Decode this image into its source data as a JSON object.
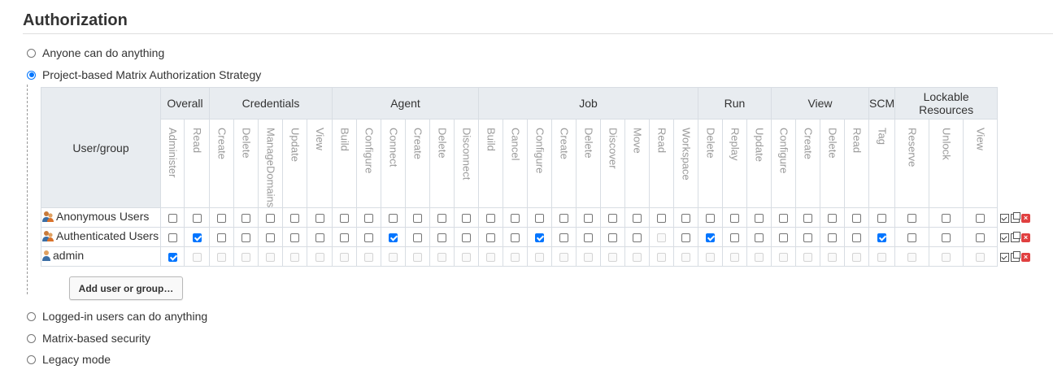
{
  "section": {
    "title": "Authorization"
  },
  "strategies": [
    {
      "label": "Anyone can do anything",
      "selected": false
    },
    {
      "label": "Project-based Matrix Authorization Strategy",
      "selected": true
    },
    {
      "label": "Logged-in users can do anything",
      "selected": false
    },
    {
      "label": "Matrix-based security",
      "selected": false
    },
    {
      "label": "Legacy mode",
      "selected": false
    }
  ],
  "matrix": {
    "user_group_header": "User/group",
    "groups": [
      {
        "label": "Overall",
        "permissions": [
          "Administer",
          "Read"
        ]
      },
      {
        "label": "Credentials",
        "permissions": [
          "Create",
          "Delete",
          "ManageDomains",
          "Update",
          "View"
        ]
      },
      {
        "label": "Agent",
        "permissions": [
          "Build",
          "Configure",
          "Connect",
          "Create",
          "Delete",
          "Disconnect"
        ]
      },
      {
        "label": "Job",
        "permissions": [
          "Build",
          "Cancel",
          "Configure",
          "Create",
          "Delete",
          "Discover",
          "Move",
          "Read",
          "Workspace"
        ]
      },
      {
        "label": "Run",
        "permissions": [
          "Delete",
          "Replay",
          "Update"
        ]
      },
      {
        "label": "View",
        "permissions": [
          "Configure",
          "Create",
          "Delete",
          "Read"
        ]
      },
      {
        "label": "SCM",
        "permissions": [
          "Tag"
        ]
      },
      {
        "label": "Lockable Resources",
        "permissions": [
          "Reserve",
          "Unlock",
          "View"
        ]
      }
    ],
    "rows": [
      {
        "name": "Anonymous Users",
        "icon": "group-icon",
        "disabled_all": false,
        "checked": [],
        "disabled": []
      },
      {
        "name": "Authenticated Users",
        "icon": "group-icon",
        "disabled_all": false,
        "checked": [
          1,
          9,
          15,
          22,
          29
        ],
        "disabled": [
          20
        ]
      },
      {
        "name": "admin",
        "icon": "user-icon",
        "disabled_all": true,
        "checked": [
          0
        ],
        "disabled": []
      }
    ],
    "row_action_icons": [
      "select-all-icon",
      "copy-icon",
      "delete-icon"
    ]
  },
  "add_button": {
    "label": "Add user or group…"
  },
  "colors": {
    "checkbox_accent": "#0075ff",
    "header_bg": "#e8ecf0",
    "delete_red": "#e04040"
  }
}
